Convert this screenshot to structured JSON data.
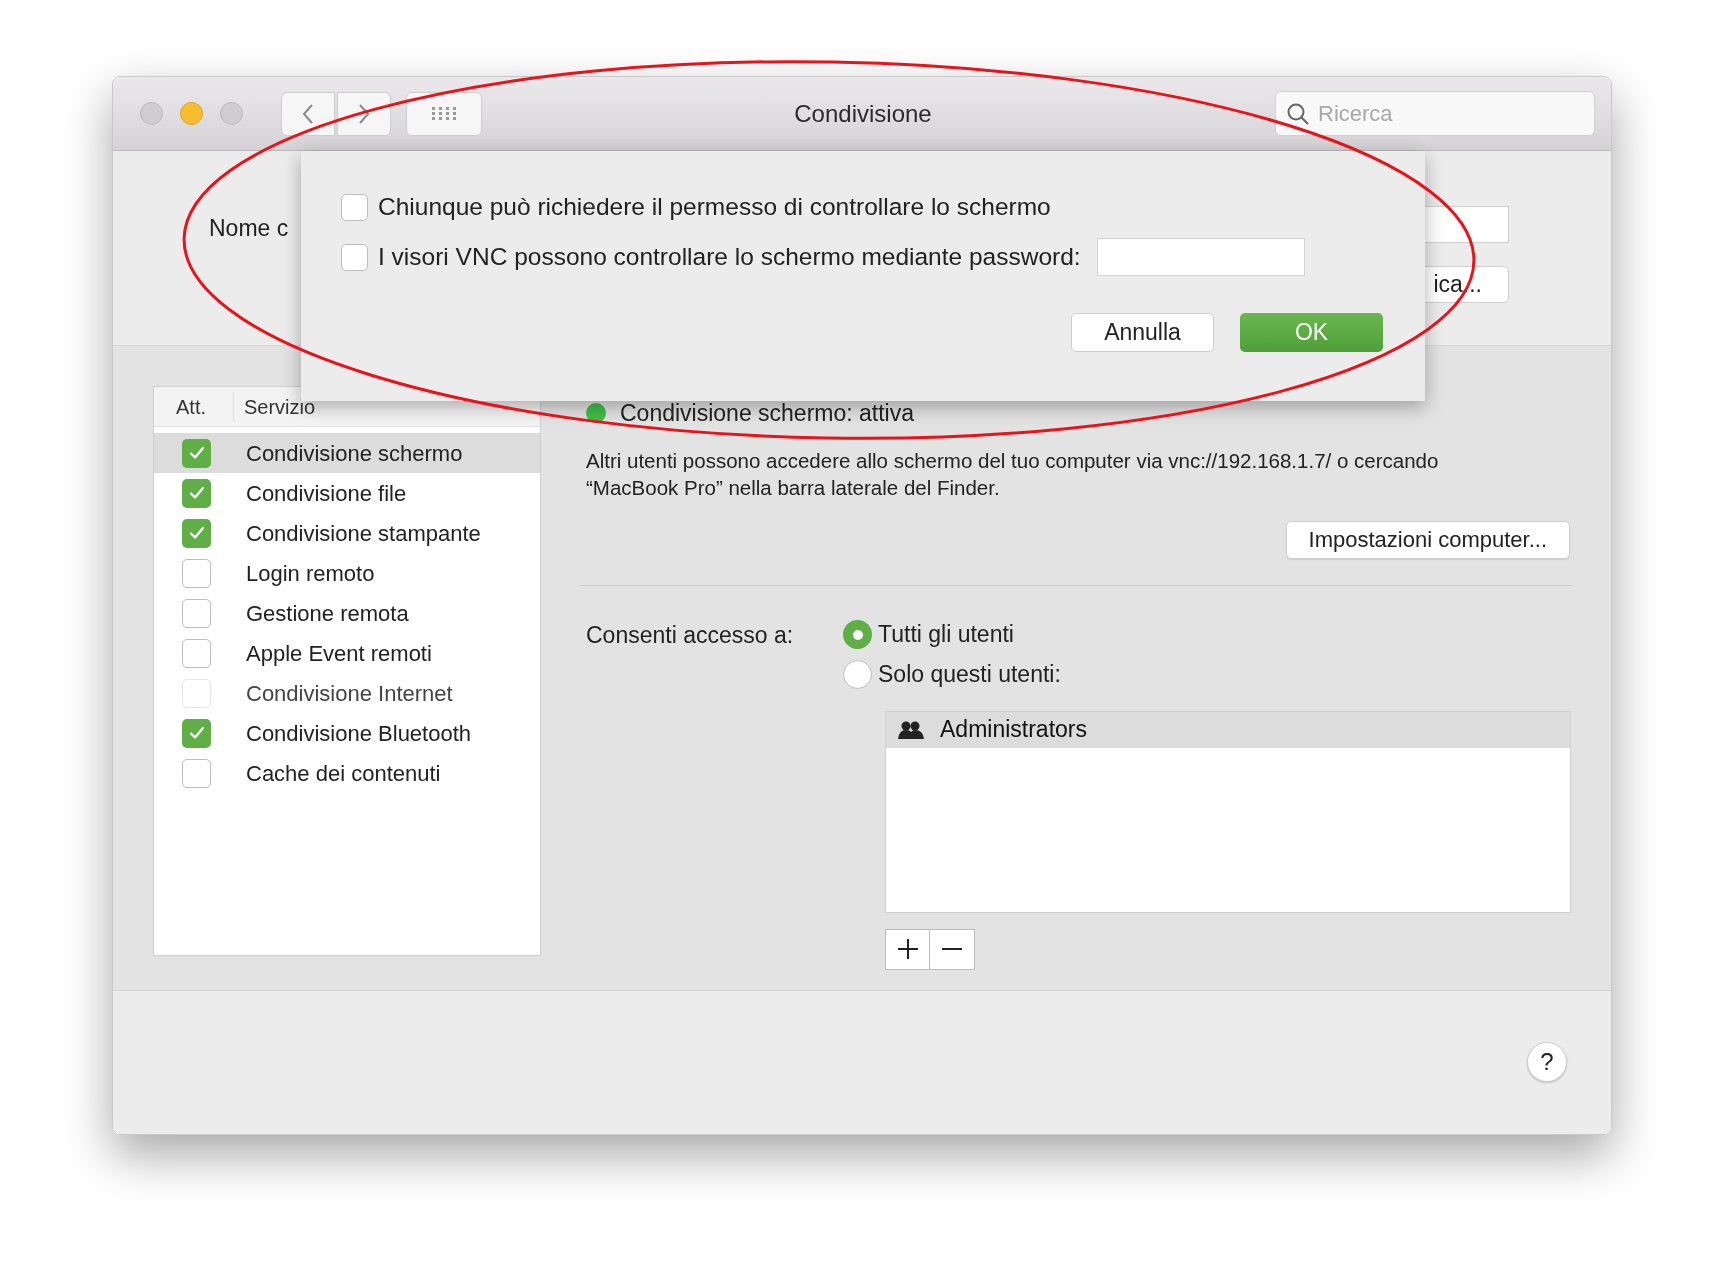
{
  "window": {
    "title": "Condivisione",
    "search": {
      "placeholder": "Ricerca"
    }
  },
  "computer_name": {
    "label": "Nome c",
    "button": "ica..."
  },
  "sheet": {
    "options": [
      {
        "kind": "checkbox",
        "label": "Chiunque può richiedere il permesso di controllare lo schermo",
        "checked": false
      },
      {
        "kind": "checkbox-with-field",
        "label": "I visori VNC possono controllare lo schermo mediante password:",
        "checked": false
      }
    ],
    "buttons": [
      {
        "kind": "secondary",
        "label": "Annulla"
      },
      {
        "kind": "primary",
        "label": "OK"
      }
    ]
  },
  "services": {
    "columns": [
      "Att.",
      "Servizio"
    ],
    "rows": [
      {
        "name": "Condivisione schermo",
        "checked": true,
        "selected": true,
        "disabled": false
      },
      {
        "name": "Condivisione file",
        "checked": true,
        "selected": false,
        "disabled": false
      },
      {
        "name": "Condivisione stampante",
        "checked": true,
        "selected": false,
        "disabled": false
      },
      {
        "name": "Login remoto",
        "checked": false,
        "selected": false,
        "disabled": false
      },
      {
        "name": "Gestione remota",
        "checked": false,
        "selected": false,
        "disabled": false
      },
      {
        "name": "Apple Event remoti",
        "checked": false,
        "selected": false,
        "disabled": false
      },
      {
        "name": "Condivisione Internet",
        "checked": false,
        "selected": false,
        "disabled": true
      },
      {
        "name": "Condivisione Bluetooth",
        "checked": true,
        "selected": false,
        "disabled": false
      },
      {
        "name": "Cache dei contenuti",
        "checked": false,
        "selected": false,
        "disabled": false
      }
    ]
  },
  "detail": {
    "status": {
      "text": "Condivisione schermo: attiva",
      "on": true
    },
    "description": "Altri utenti possono accedere allo schermo del tuo computer via vnc://192.168.1.7/ o cercando “MacBook Pro” nella barra laterale del Finder.",
    "settings_button": "Impostazioni computer...",
    "access_label": "Consenti accesso a:",
    "access_options": [
      {
        "label": "Tutti gli utenti",
        "selected": true
      },
      {
        "label": "Solo questi utenti:",
        "selected": false
      }
    ],
    "users": [
      {
        "name": "Administrators",
        "selected": true
      }
    ]
  },
  "help": "?"
}
